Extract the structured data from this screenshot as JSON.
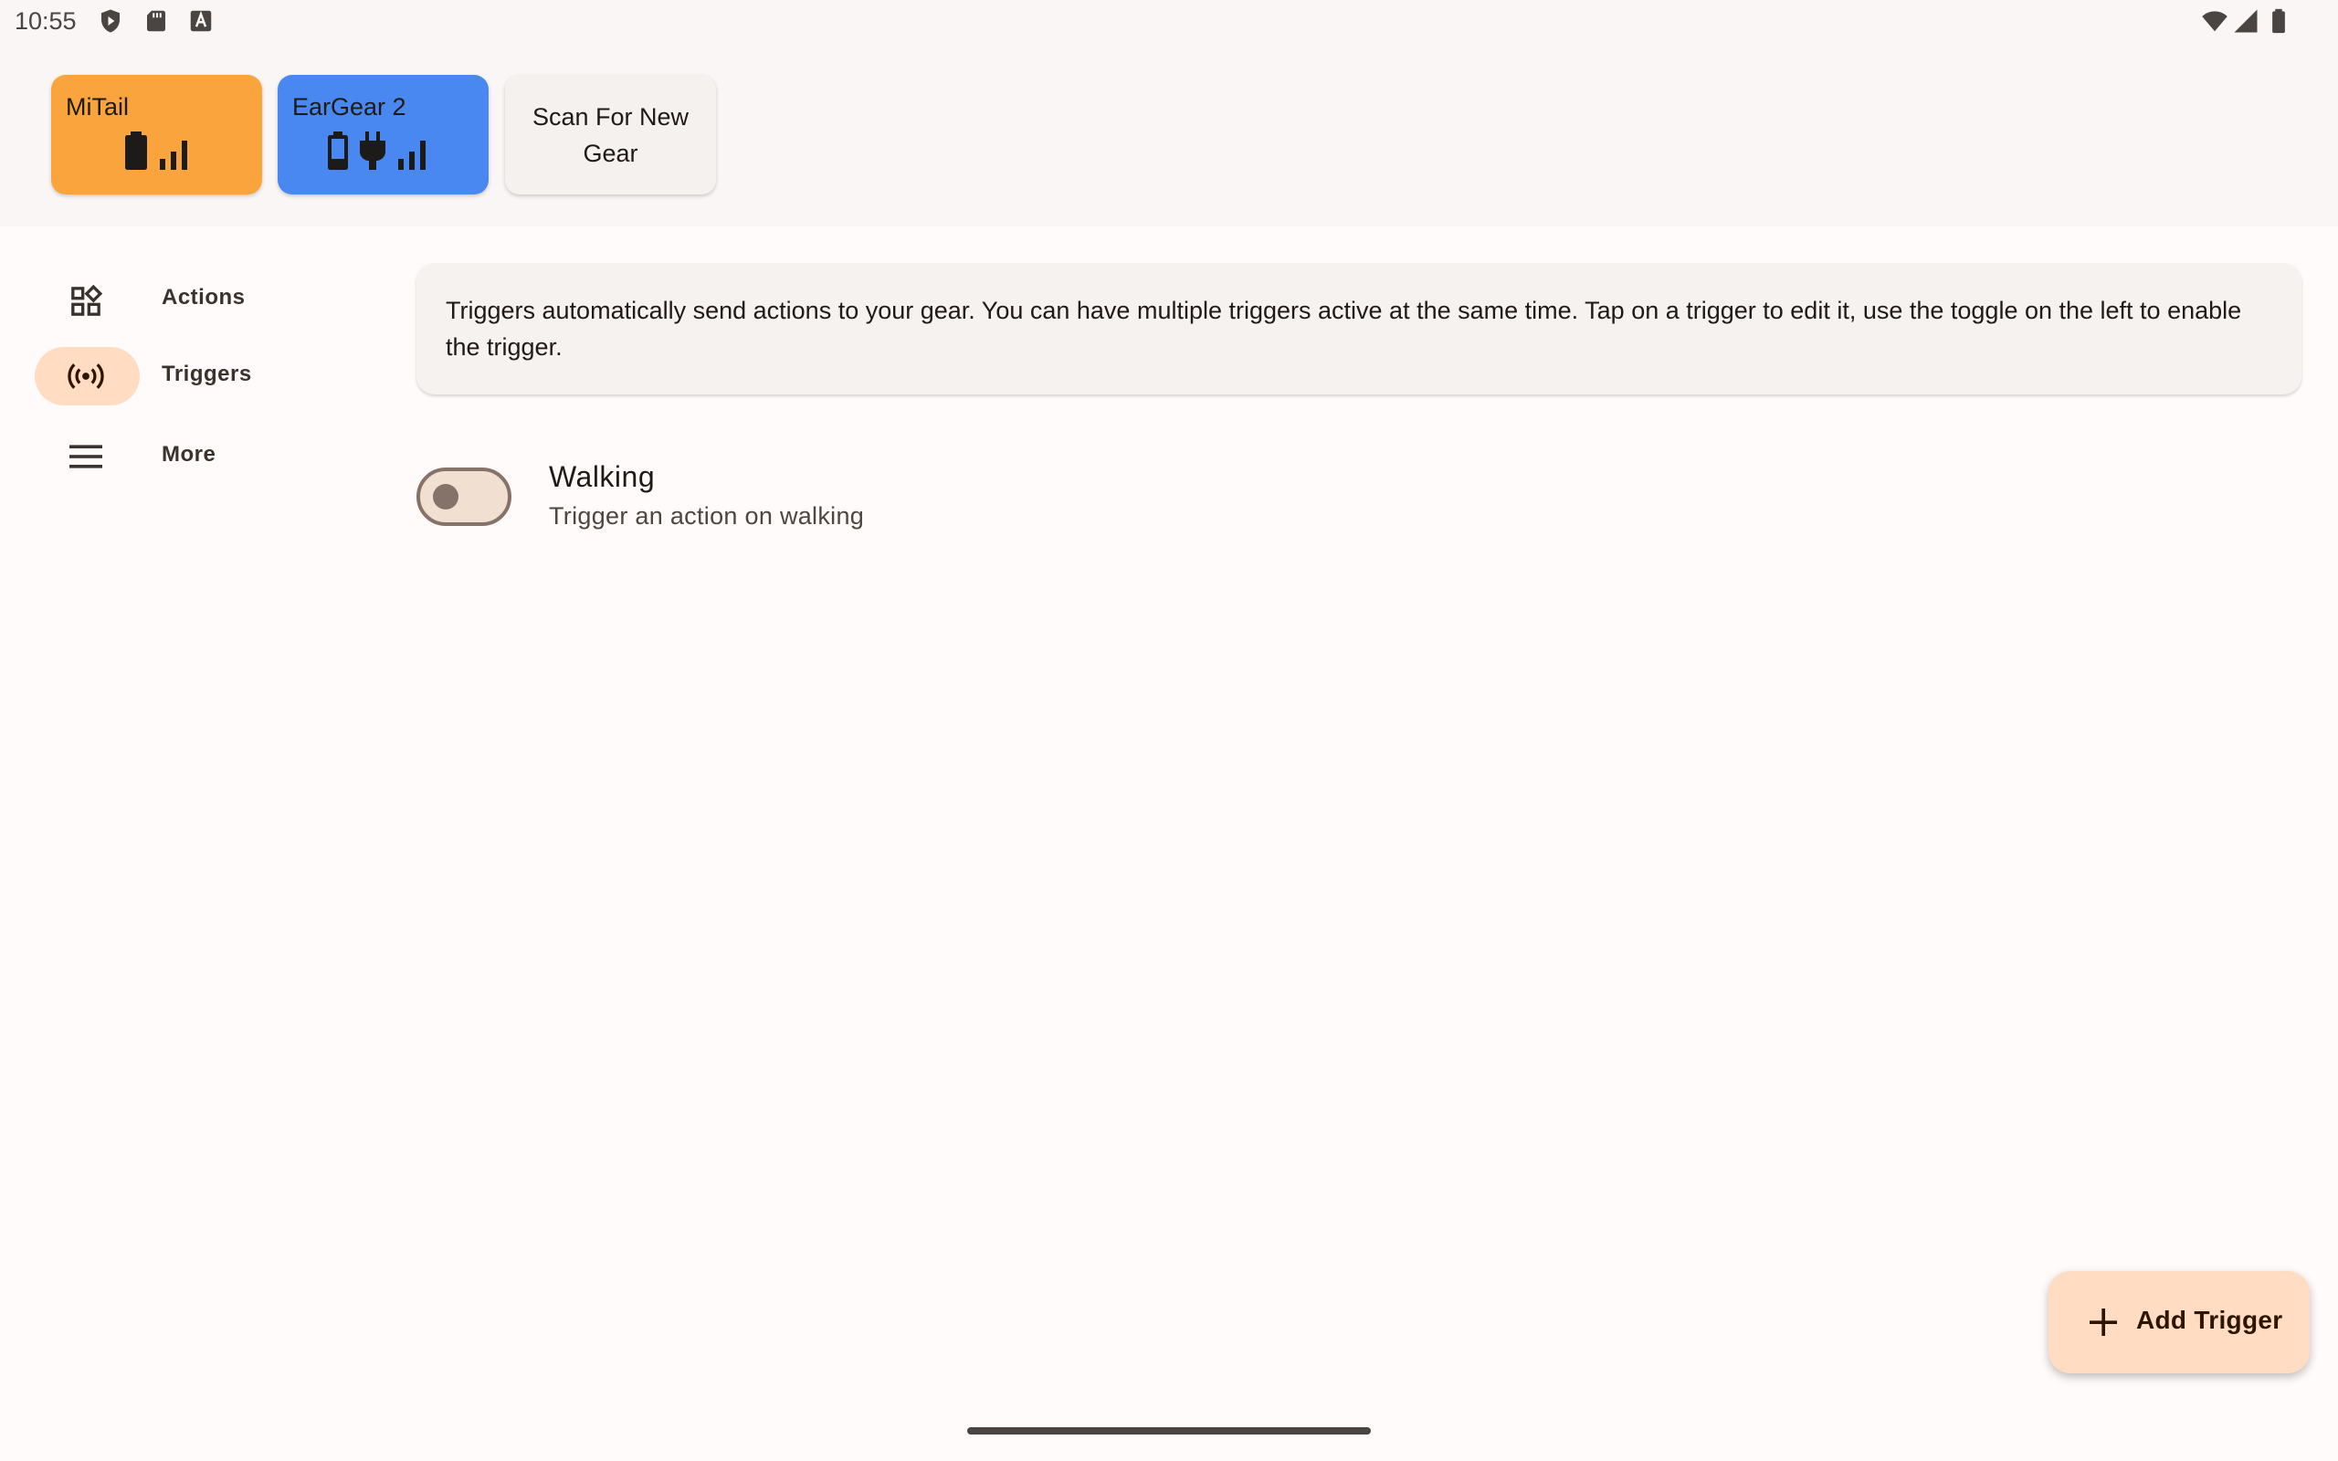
{
  "status_bar": {
    "time": "10:55",
    "left_icons": [
      "play-protect-icon",
      "sd-card-icon",
      "keyboard-a-icon"
    ],
    "right_icons": [
      "wifi-icon",
      "cell-signal-icon",
      "battery-icon"
    ]
  },
  "gear": {
    "cards": [
      {
        "name": "MiTail",
        "color": "#f9a43c",
        "icons": [
          "battery-icon",
          "signal-bars-icon"
        ]
      },
      {
        "name": "EarGear 2",
        "color": "#4888f0",
        "icons": [
          "battery-icon",
          "charging-plug-icon",
          "signal-bars-icon"
        ]
      }
    ],
    "scan_button": "Scan For New Gear"
  },
  "nav": {
    "items": [
      {
        "label": "Actions",
        "icon": "widgets-icon",
        "active": false
      },
      {
        "label": "Triggers",
        "icon": "sensors-icon",
        "active": true
      },
      {
        "label": "More",
        "icon": "menu-icon",
        "active": false
      }
    ],
    "active_color": "#ffdcc2"
  },
  "info": {
    "text": "Triggers automatically send actions to your gear. You can have multiple triggers active at the same time. Tap on a trigger to edit it, use the toggle on the left to enable the trigger."
  },
  "triggers": [
    {
      "title": "Walking",
      "subtitle": "Trigger an action on walking",
      "enabled": false
    }
  ],
  "fab": {
    "label": "Add Trigger",
    "icon": "plus-icon"
  }
}
